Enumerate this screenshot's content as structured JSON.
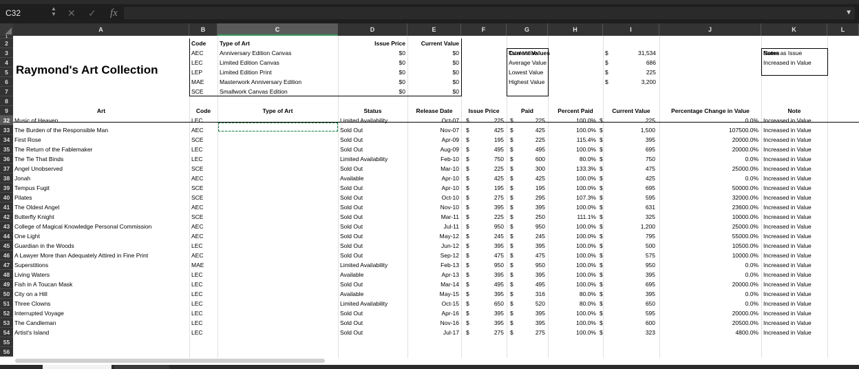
{
  "name_box": "C32",
  "fx_label": "fx",
  "cancel_glyph": "✕",
  "confirm_glyph": "✓",
  "dropdown_glyph": "▼",
  "columns": [
    "A",
    "B",
    "C",
    "D",
    "E",
    "F",
    "G",
    "H",
    "I",
    "J",
    "K",
    "L"
  ],
  "selected_column": "C",
  "selected_row": "32",
  "header_rows": [
    "1",
    "2",
    "3",
    "4",
    "5",
    "6",
    "7",
    "8",
    "9"
  ],
  "title": "Raymond's Art Collection",
  "code_table": {
    "headers": [
      "Code",
      "Type of Art",
      "Issue Price",
      "Current Value"
    ],
    "rows": [
      [
        "AEC",
        "Anniversary Edition Canvas",
        "$0",
        "$0"
      ],
      [
        "LEC",
        "Limited Edition Canvas",
        "$0",
        "$0"
      ],
      [
        "LEP",
        "Limited Edition Print",
        "$0",
        "$0"
      ],
      [
        "MAE",
        "Masterwork Anniversary Edition",
        "$0",
        "$0"
      ],
      [
        "SCE",
        "Smallwork Canvas Edition",
        "$0",
        "$0"
      ]
    ]
  },
  "current_values": {
    "header": "Current Values",
    "rows": [
      [
        "Total Value",
        "$",
        "31,534"
      ],
      [
        "Average Value",
        "$",
        "686"
      ],
      [
        "Lowest Value",
        "$",
        "225"
      ],
      [
        "Highest Value",
        "$",
        "3,200"
      ]
    ]
  },
  "notes": {
    "header": "Notes",
    "items": [
      "Same as Issue",
      "Increased in Value"
    ]
  },
  "table_headers": [
    "Art",
    "Code",
    "Type of Art",
    "Status",
    "Release Date",
    "Issue Price",
    "Paid",
    "Percent Paid",
    "Current Value",
    "Percentage Change in Value",
    "Note"
  ],
  "rows": [
    {
      "n": "32",
      "art": "Music of Heaven",
      "code": "LEC",
      "status": "Limited Availability",
      "date": "Oct-07",
      "issue": "225",
      "paid": "225",
      "pct": "100.0%",
      "cur": "225",
      "chg": "0.0%",
      "note": "Increased in Value"
    },
    {
      "n": "33",
      "art": "The Burden of the Responsible Man",
      "code": "AEC",
      "status": "Sold Out",
      "date": "Nov-07",
      "issue": "425",
      "paid": "425",
      "pct": "100.0%",
      "cur": "1,500",
      "chg": "107500.0%",
      "note": "Increased in Value"
    },
    {
      "n": "34",
      "art": "First Rose",
      "code": "SCE",
      "status": "Sold Out",
      "date": "Apr-09",
      "issue": "195",
      "paid": "225",
      "pct": "115.4%",
      "cur": "395",
      "chg": "20000.0%",
      "note": "Increased in Value"
    },
    {
      "n": "35",
      "art": "The Return of the Fablemaker",
      "code": "LEC",
      "status": "Sold Out",
      "date": "Aug-09",
      "issue": "495",
      "paid": "495",
      "pct": "100.0%",
      "cur": "695",
      "chg": "20000.0%",
      "note": "Increased in Value"
    },
    {
      "n": "36",
      "art": "The Tie That Binds",
      "code": "LEC",
      "status": "Limited Availability",
      "date": "Feb-10",
      "issue": "750",
      "paid": "600",
      "pct": "80.0%",
      "cur": "750",
      "chg": "0.0%",
      "note": "Increased in Value"
    },
    {
      "n": "37",
      "art": "Angel Unobserved",
      "code": "SCE",
      "status": "Sold Out",
      "date": "Mar-10",
      "issue": "225",
      "paid": "300",
      "pct": "133.3%",
      "cur": "475",
      "chg": "25000.0%",
      "note": "Increased in Value"
    },
    {
      "n": "38",
      "art": "Jonah",
      "code": "AEC",
      "status": "Available",
      "date": "Apr-10",
      "issue": "425",
      "paid": "425",
      "pct": "100.0%",
      "cur": "425",
      "chg": "0.0%",
      "note": "Increased in Value"
    },
    {
      "n": "39",
      "art": "Tempus Fugit",
      "code": "SCE",
      "status": "Sold Out",
      "date": "Apr-10",
      "issue": "195",
      "paid": "195",
      "pct": "100.0%",
      "cur": "695",
      "chg": "50000.0%",
      "note": "Increased in Value"
    },
    {
      "n": "40",
      "art": "Pilates",
      "code": "SCE",
      "status": "Sold Out",
      "date": "Oct-10",
      "issue": "275",
      "paid": "295",
      "pct": "107.3%",
      "cur": "595",
      "chg": "32000.0%",
      "note": "Increased in Value"
    },
    {
      "n": "41",
      "art": "The Oldest Angel",
      "code": "AEC",
      "status": "Sold Out",
      "date": "Nov-10",
      "issue": "395",
      "paid": "395",
      "pct": "100.0%",
      "cur": "631",
      "chg": "23600.0%",
      "note": "Increased in Value"
    },
    {
      "n": "42",
      "art": "Butterfly Knight",
      "code": "SCE",
      "status": "Sold Out",
      "date": "Mar-11",
      "issue": "225",
      "paid": "250",
      "pct": "111.1%",
      "cur": "325",
      "chg": "10000.0%",
      "note": "Increased in Value"
    },
    {
      "n": "43",
      "art": "College of Magical Knowledge Personal Commission",
      "code": "AEC",
      "status": "Sold Out",
      "date": "Jul-11",
      "issue": "950",
      "paid": "950",
      "pct": "100.0%",
      "cur": "1,200",
      "chg": "25000.0%",
      "note": "Increased in Value"
    },
    {
      "n": "44",
      "art": "One Light",
      "code": "AEC",
      "status": "Sold Out",
      "date": "May-12",
      "issue": "245",
      "paid": "245",
      "pct": "100.0%",
      "cur": "795",
      "chg": "55000.0%",
      "note": "Increased in Value"
    },
    {
      "n": "45",
      "art": "Guardian in the Woods",
      "code": "LEC",
      "status": "Sold Out",
      "date": "Jun-12",
      "issue": "395",
      "paid": "395",
      "pct": "100.0%",
      "cur": "500",
      "chg": "10500.0%",
      "note": "Increased in Value"
    },
    {
      "n": "46",
      "art": "A Lawyer More than Adequately Attired in Fine Print",
      "code": "AEC",
      "status": "Sold Out",
      "date": "Sep-12",
      "issue": "475",
      "paid": "475",
      "pct": "100.0%",
      "cur": "575",
      "chg": "10000.0%",
      "note": "Increased in Value"
    },
    {
      "n": "47",
      "art": "Superstitions",
      "code": "MAE",
      "status": "Limited Availability",
      "date": "Feb-13",
      "issue": "950",
      "paid": "950",
      "pct": "100.0%",
      "cur": "950",
      "chg": "0.0%",
      "note": "Increased in Value"
    },
    {
      "n": "48",
      "art": "Living Waters",
      "code": "LEC",
      "status": "Available",
      "date": "Apr-13",
      "issue": "395",
      "paid": "395",
      "pct": "100.0%",
      "cur": "395",
      "chg": "0.0%",
      "note": "Increased in Value"
    },
    {
      "n": "49",
      "art": "Fish in A Toucan Mask",
      "code": "LEC",
      "status": "Sold Out",
      "date": "Mar-14",
      "issue": "495",
      "paid": "495",
      "pct": "100.0%",
      "cur": "695",
      "chg": "20000.0%",
      "note": "Increased in Value"
    },
    {
      "n": "50",
      "art": "City on a Hill",
      "code": "LEC",
      "status": "Available",
      "date": "May-15",
      "issue": "395",
      "paid": "316",
      "pct": "80.0%",
      "cur": "395",
      "chg": "0.0%",
      "note": "Increased in Value"
    },
    {
      "n": "51",
      "art": "Three Clowns",
      "code": "LEC",
      "status": "Limited Availability",
      "date": "Oct-15",
      "issue": "650",
      "paid": "520",
      "pct": "80.0%",
      "cur": "650",
      "chg": "0.0%",
      "note": "Increased in Value"
    },
    {
      "n": "52",
      "art": "Interrupted Voyage",
      "code": "LEC",
      "status": "Sold Out",
      "date": "Apr-16",
      "issue": "395",
      "paid": "395",
      "pct": "100.0%",
      "cur": "595",
      "chg": "20000.0%",
      "note": "Increased in Value"
    },
    {
      "n": "53",
      "art": "The Candleman",
      "code": "LEC",
      "status": "Sold Out",
      "date": "Nov-16",
      "issue": "395",
      "paid": "395",
      "pct": "100.0%",
      "cur": "600",
      "chg": "20500.0%",
      "note": "Increased in Value"
    },
    {
      "n": "54",
      "art": "Artist's Island",
      "code": "LEC",
      "status": "Sold Out",
      "date": "Jul-17",
      "issue": "275",
      "paid": "275",
      "pct": "100.0%",
      "cur": "323",
      "chg": "4800.0%",
      "note": "Increased in Value"
    }
  ],
  "trailing_rows": [
    "55",
    "56"
  ],
  "currency_symbol": "$"
}
